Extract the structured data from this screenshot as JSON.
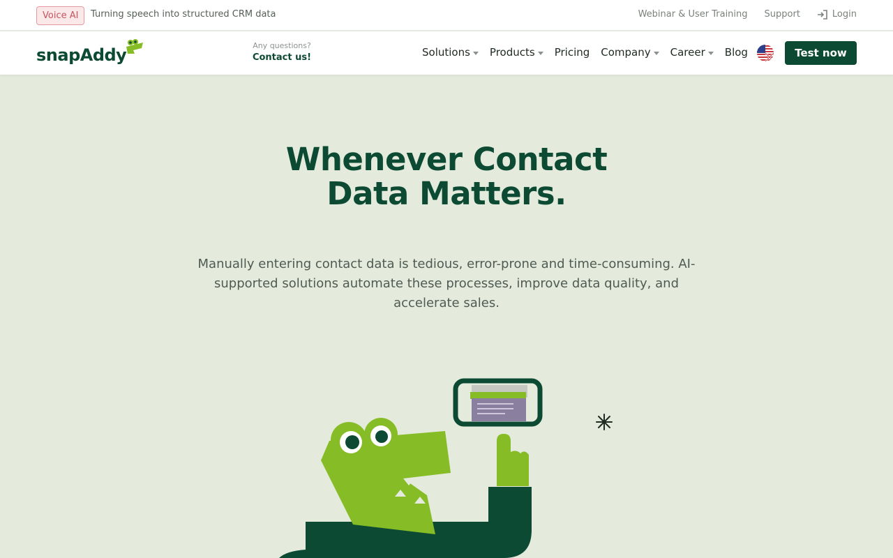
{
  "topbar": {
    "badge": "Voice AI",
    "tagline": "Turning speech into structured CRM data",
    "links": {
      "webinar": "Webinar & User Training",
      "support": "Support",
      "login": "Login"
    }
  },
  "nav": {
    "logo": "snapAddy",
    "contact_question": "Any questions?",
    "contact_link": "Contact us!",
    "menu": [
      {
        "label": "Solutions",
        "dropdown": true
      },
      {
        "label": "Products",
        "dropdown": true
      },
      {
        "label": "Pricing",
        "dropdown": false
      },
      {
        "label": "Company",
        "dropdown": true
      },
      {
        "label": "Career",
        "dropdown": true
      },
      {
        "label": "Blog",
        "dropdown": false
      }
    ],
    "language_icon": "uk-us-flag-icon",
    "cta": "Test now"
  },
  "hero": {
    "title_line1": "Whenever Contact",
    "title_line2": "Data Matters.",
    "text": "Manually entering contact data is tedious, error-prone and time-consuming. AI-supported solutions automate these processes, improve data quality, and accelerate sales."
  },
  "colors": {
    "brand_green": "#0d4a33",
    "lime": "#86bc25",
    "hero_bg": "#e4ebdc",
    "badge_red": "#c6545c"
  }
}
